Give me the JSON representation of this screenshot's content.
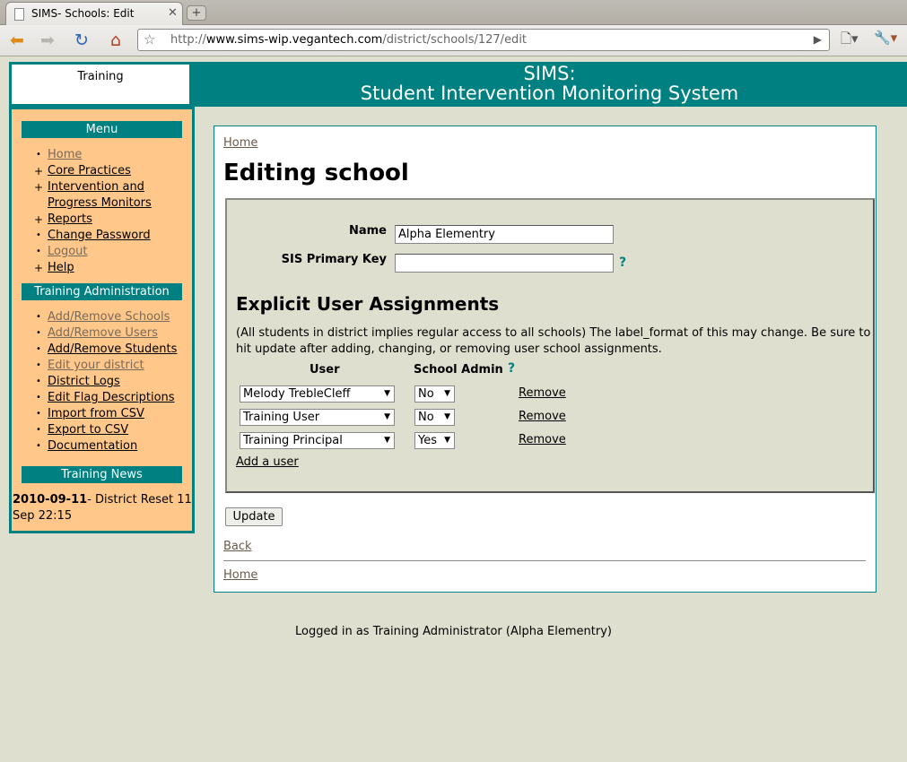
{
  "browser": {
    "tab_title": "SIMS- Schools: Edit",
    "tab_close": "✕",
    "new_tab": "+",
    "url_prefix": "http://",
    "url_host": "www.sims-wip.vegantech.com",
    "url_path": "/district/schools/127/edit"
  },
  "header": {
    "logo_text": "Training",
    "title": "SIMS:",
    "subtitle": "Student Intervention Monitoring System"
  },
  "sidebar": {
    "menu_title": "Menu",
    "menu_items": [
      {
        "label": "Home",
        "mark": "•"
      },
      {
        "label": "Core Practices",
        "mark": "+"
      },
      {
        "label": "Intervention and Progress Monitors",
        "mark": "+"
      },
      {
        "label": "Reports",
        "mark": "+"
      },
      {
        "label": "Change Password",
        "mark": "•"
      },
      {
        "label": "Logout",
        "mark": "•"
      },
      {
        "label": "Help",
        "mark": "+"
      }
    ],
    "admin_title": "Training Administration",
    "admin_items": [
      {
        "label": "Add/Remove Schools"
      },
      {
        "label": "Add/Remove Users"
      },
      {
        "label": "Add/Remove Students"
      },
      {
        "label": "Edit your district"
      },
      {
        "label": "District Logs"
      },
      {
        "label": "Edit Flag Descriptions"
      },
      {
        "label": "Import from CSV"
      },
      {
        "label": "Export to CSV"
      },
      {
        "label": "Documentation"
      }
    ],
    "news_title": "Training News",
    "news_date": "2010-09-11",
    "news_text": "- District Reset 11 Sep 22:15"
  },
  "content": {
    "breadcrumb_home": "Home",
    "page_title": "Editing school",
    "name_label": "Name",
    "name_value": "Alpha Elementry",
    "sis_label": "SIS Primary Key",
    "sis_value": "",
    "help_mark": "?",
    "assign_title": "Explicit User Assignments",
    "assign_note": "(All students in district implies regular access to all schools) The label_format of this may change. Be sure to hit update after adding, changing, or removing user school assignments.",
    "col_user": "User",
    "col_admin": "School Admin",
    "assignments": [
      {
        "user": "Melody TrebleCleff",
        "admin": "No",
        "action": "Remove"
      },
      {
        "user": "Training User",
        "admin": "No",
        "action": "Remove"
      },
      {
        "user": "Training Principal",
        "admin": "Yes",
        "action": "Remove"
      }
    ],
    "add_user": "Add a user",
    "update_button": "Update",
    "back_link": "Back",
    "bottom_home": "Home"
  },
  "footer": {
    "text": "Logged in as Training Administrator (Alpha Elementry)"
  }
}
